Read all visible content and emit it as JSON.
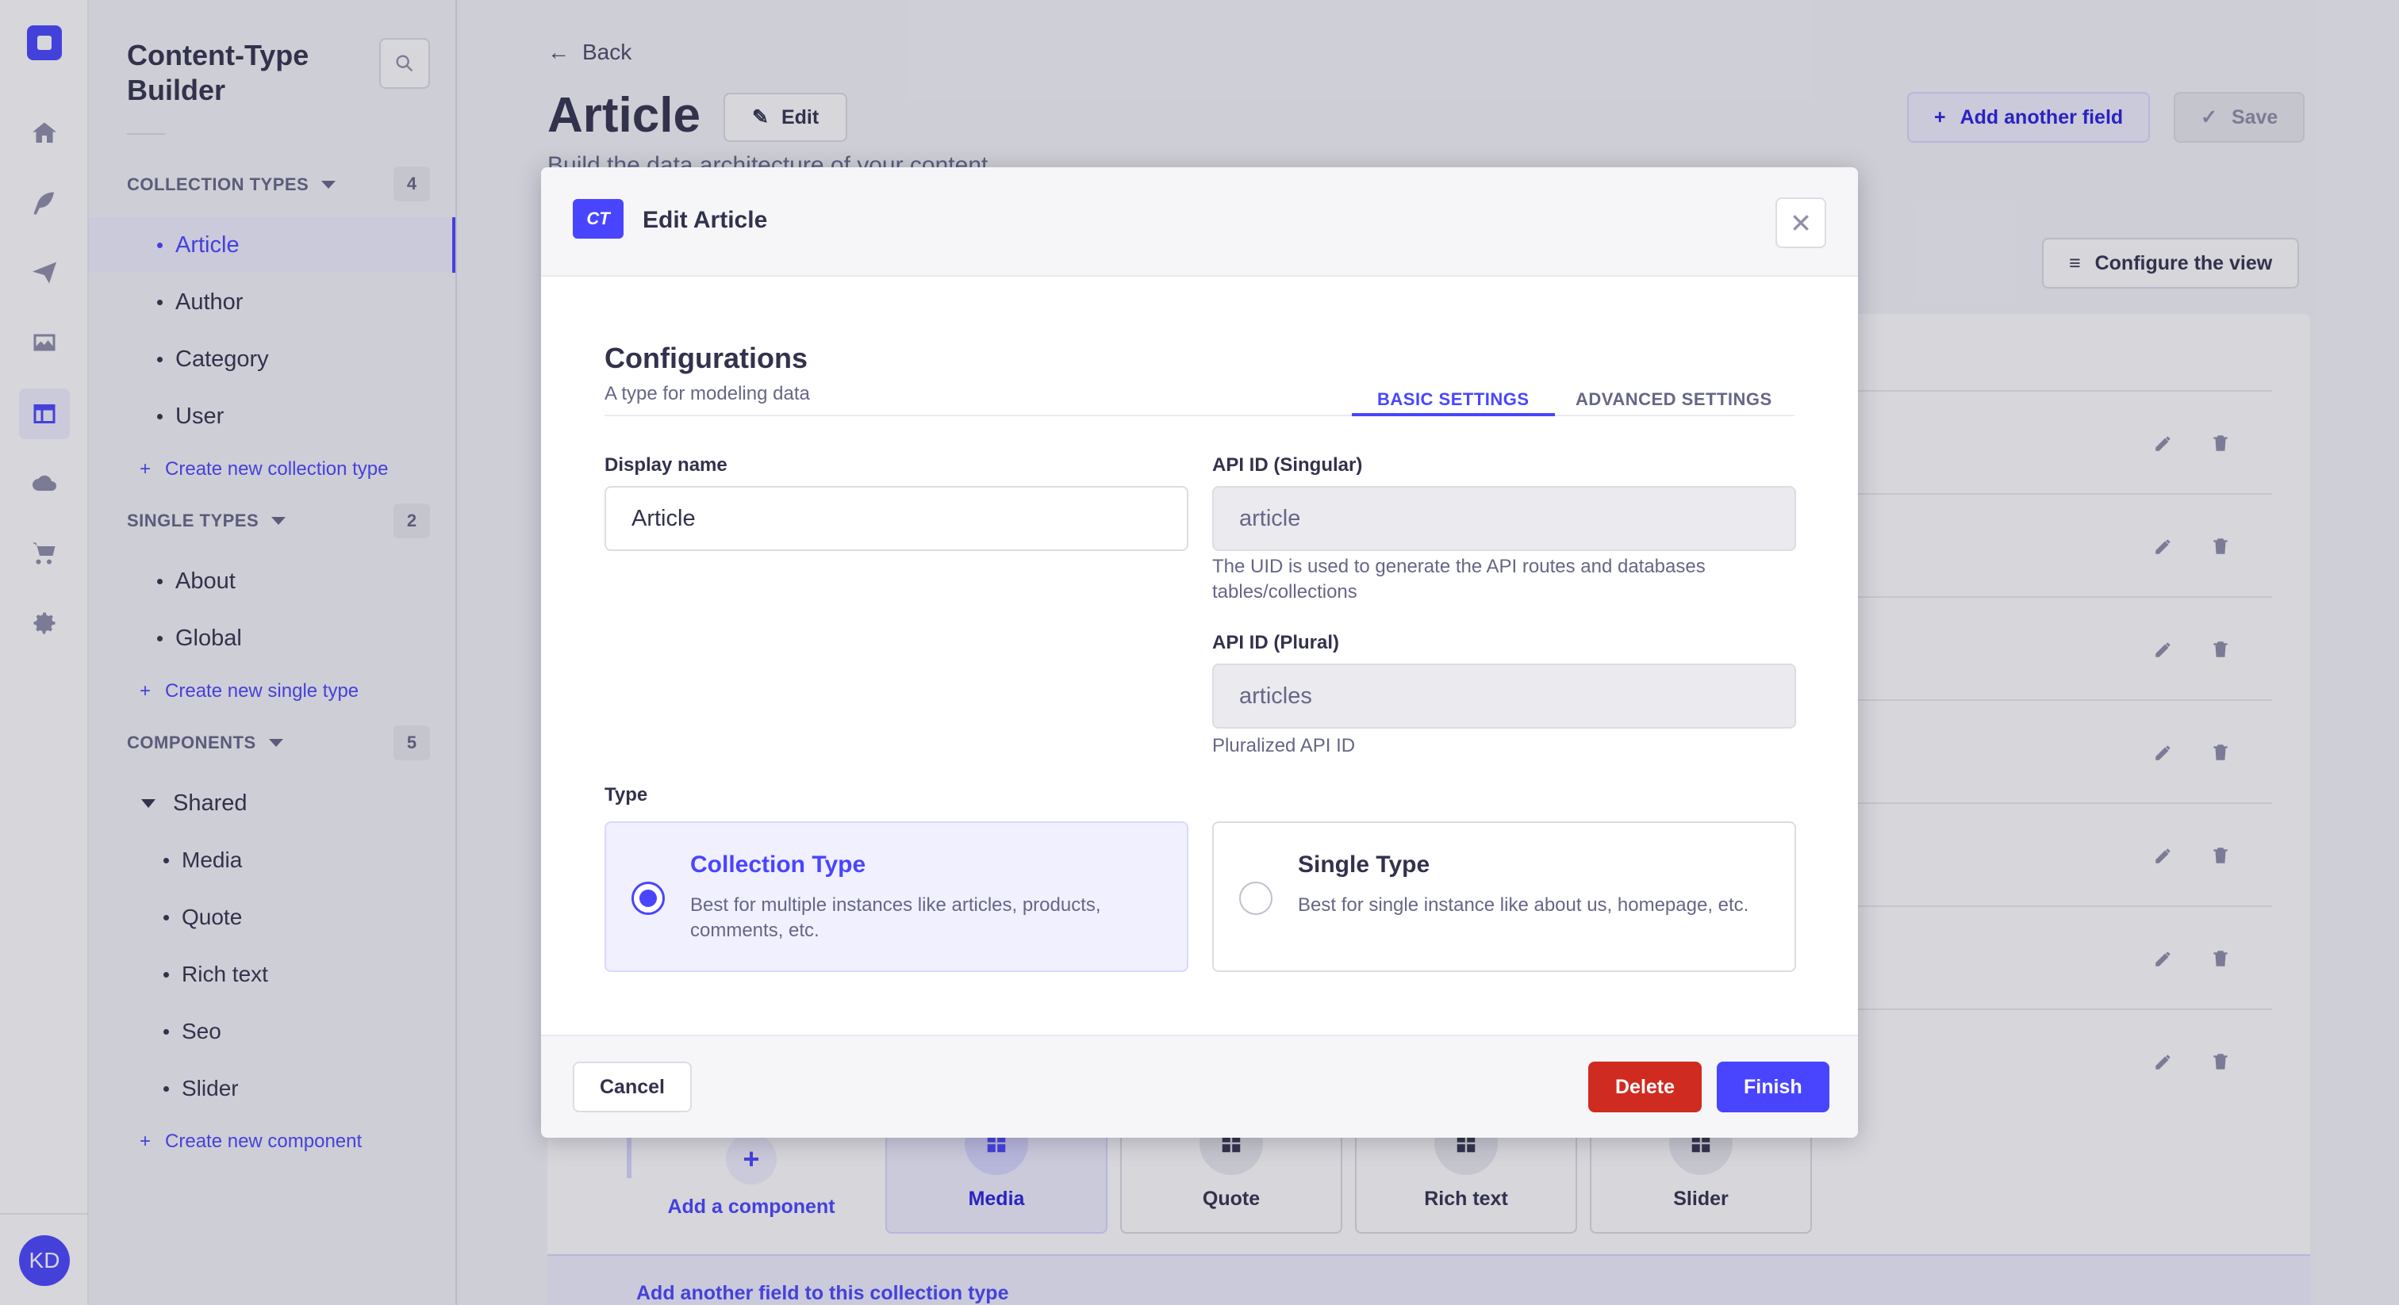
{
  "colors": {
    "primary": "#4945ff",
    "danger": "#d02b20",
    "primary_light": "#f0f0ff",
    "text": "#32324d",
    "muted": "#666687"
  },
  "rail": {
    "icons": [
      "strapi-logo-icon",
      "home-icon",
      "feather-icon",
      "paper-plane-icon",
      "image-icon",
      "layout-icon",
      "cloud-icon",
      "cart-icon",
      "gear-icon"
    ],
    "avatar_initials": "KD"
  },
  "subnav": {
    "title": "Content-Type Builder",
    "collection_types": {
      "label": "COLLECTION TYPES",
      "count": "4",
      "items": [
        "Article",
        "Author",
        "Category",
        "User"
      ],
      "create_label": "Create new collection type"
    },
    "single_types": {
      "label": "SINGLE TYPES",
      "count": "2",
      "items": [
        "About",
        "Global"
      ],
      "create_label": "Create new single type"
    },
    "components": {
      "label": "COMPONENTS",
      "count": "5",
      "group": "Shared",
      "items": [
        "Media",
        "Quote",
        "Rich text",
        "Seo",
        "Slider"
      ],
      "create_label": "Create new component"
    }
  },
  "main": {
    "back_label": "Back",
    "page_title": "Article",
    "edit_label": "Edit",
    "subtitle": "Build the data architecture of your content",
    "add_field_label": "Add another field",
    "save_label": "Save",
    "configure_label": "Configure the view",
    "add_component_label": "Add a component",
    "component_tabs": [
      "Media",
      "Quote",
      "Rich text",
      "Slider"
    ],
    "add_another_field_label": "Add another field to this collection type"
  },
  "modal": {
    "badge": "CT",
    "title": "Edit Article",
    "section_title": "Configurations",
    "section_subtitle": "A type for modeling data",
    "tabs": [
      "BASIC SETTINGS",
      "ADVANCED SETTINGS"
    ],
    "display_name": {
      "label": "Display name",
      "value": "Article"
    },
    "api_singular": {
      "label": "API ID (Singular)",
      "value": "article",
      "hint": "The UID is used to generate the API routes and databases tables/collections"
    },
    "api_plural": {
      "label": "API ID (Plural)",
      "value": "articles",
      "hint": "Pluralized API ID"
    },
    "type_label": "Type",
    "types": [
      {
        "title": "Collection Type",
        "desc": "Best for multiple instances like articles, products, comments, etc.",
        "selected": true
      },
      {
        "title": "Single Type",
        "desc": "Best for single instance like about us, homepage, etc.",
        "selected": false
      }
    ],
    "cancel_label": "Cancel",
    "delete_label": "Delete",
    "finish_label": "Finish"
  }
}
